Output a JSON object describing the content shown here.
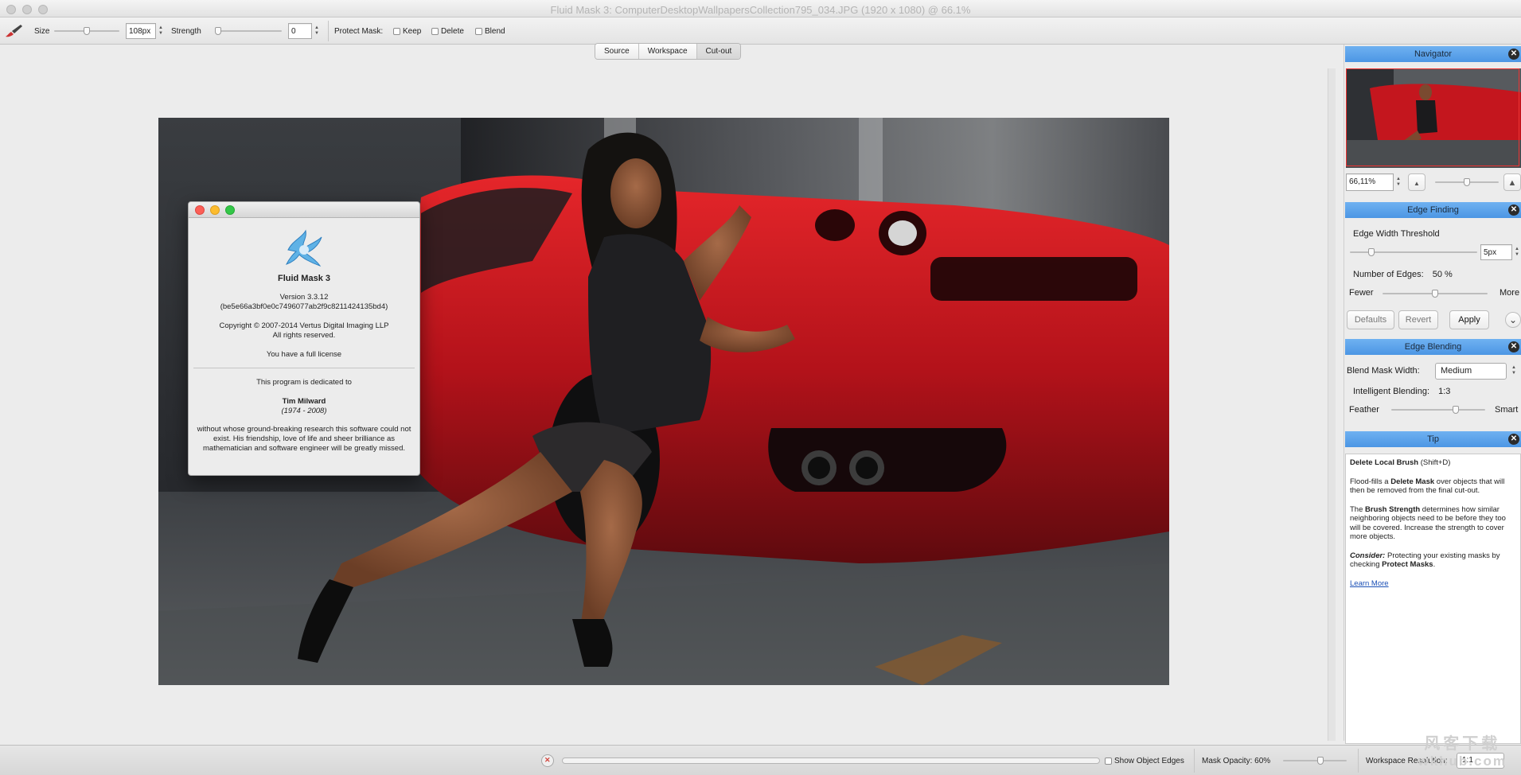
{
  "window": {
    "title": "Fluid Mask 3: ComputerDesktopWallpapersCollection795_034.JPG (1920 x 1080) @ 66.1%"
  },
  "toolbar": {
    "brush_icon": "brush-icon",
    "size_label": "Size",
    "size_value": "108px",
    "size_level": 0.5,
    "strength_label": "Strength",
    "strength_value": "0",
    "strength_level": 0.0,
    "protect_mask_label": "Protect Mask:",
    "keep_label": "Keep",
    "delete_label": "Delete",
    "blend_label": "Blend"
  },
  "tabs": [
    {
      "label": "Source",
      "active": false
    },
    {
      "label": "Workspace",
      "active": false
    },
    {
      "label": "Cut-out",
      "active": true
    }
  ],
  "about": {
    "app_name": "Fluid Mask 3",
    "version": "Version 3.3.12",
    "build_hash": "(be5e66a3bf0e0c7496077ab2f9c8211424135bd4)",
    "copyright": "Copyright © 2007-2014 Vertus Digital Imaging LLP",
    "rights": "All rights reserved.",
    "license": "You have a full license",
    "dedicated_to": "This program is dedicated to",
    "person_name": "Tim Milward",
    "person_years": "(1974 - 2008)",
    "tribute": "without whose ground-breaking research this software could not exist. His friendship, love of life and sheer brilliance as mathematician and software engineer will be greatly missed."
  },
  "navigator": {
    "header": "Navigator",
    "zoom_value": "66,11%",
    "zoom_level": 0.5
  },
  "edge_finding": {
    "header": "Edge Finding",
    "threshold_label": "Edge Width Threshold",
    "threshold_value": "5px",
    "threshold_level": 0.15,
    "edges_label": "Number of Edges:",
    "edges_value": "50 %",
    "edges_level": 0.5,
    "fewer_label": "Fewer",
    "more_label": "More",
    "defaults_label": "Defaults",
    "revert_label": "Revert",
    "apply_label": "Apply"
  },
  "edge_blending": {
    "header": "Edge Blending",
    "mask_width_label": "Blend Mask Width:",
    "mask_width_value": "Medium",
    "intelligent_label": "Intelligent Blending:",
    "intelligent_value": "1:3",
    "feather_label": "Feather",
    "smart_label": "Smart",
    "feather_level": 0.7
  },
  "tip": {
    "header": "Tip",
    "title_bold": "Delete Local Brush",
    "title_shortcut": " (Shift+D)",
    "p1_a": "Flood-fills a ",
    "p1_b": "Delete Mask",
    "p1_c": " over objects that will then be removed from the final cut-out.",
    "p2_a": "The ",
    "p2_b": "Brush Strength",
    "p2_c": " determines how similar neighboring objects need to be before they too will be covered. Increase the strength to cover more objects.",
    "p3_a": "Consider:",
    "p3_b": " Protecting your existing masks by checking ",
    "p3_c": "Protect Masks",
    "p3_d": ".",
    "learn_more": "Learn More"
  },
  "statusbar": {
    "show_edges_label": "Show Object Edges",
    "mask_opacity_label": "Mask Opacity: 60%",
    "mask_opacity_level": 0.6,
    "resolution_label": "Workspace Resolution:",
    "resolution_value": "1:1"
  },
  "watermark": {
    "line1": "风客下载",
    "line2": "wkhub.com"
  }
}
